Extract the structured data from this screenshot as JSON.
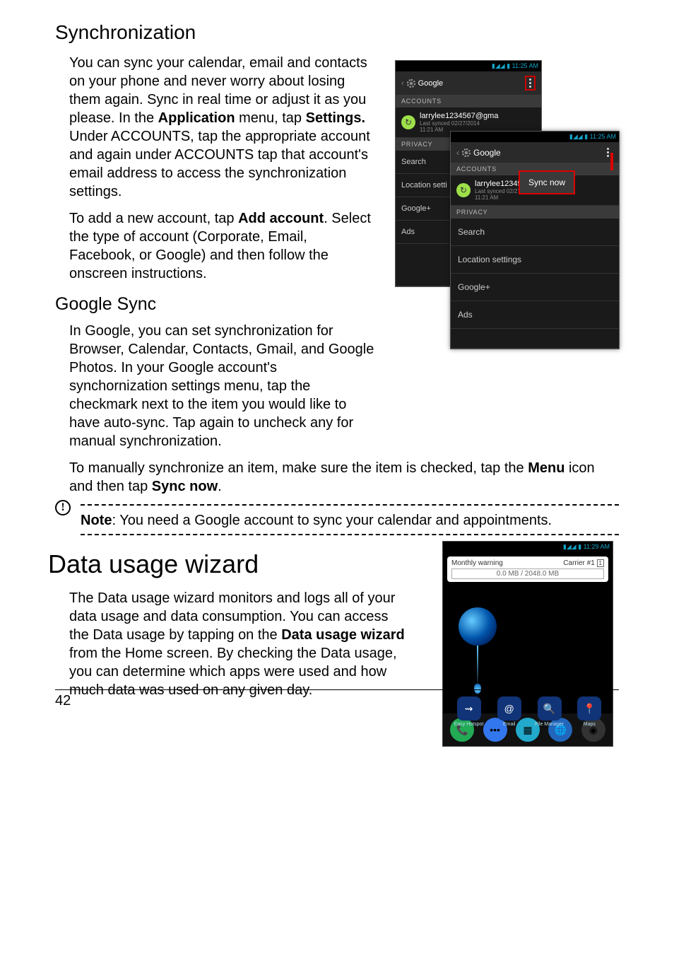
{
  "sync": {
    "heading": "Synchronization",
    "p1_a": "You can sync your calendar, email and contacts on your phone and never worry about losing them again. Sync in real time or adjust it as you please. In the ",
    "p1_b": "Application",
    "p1_c": " menu, tap ",
    "p1_d": "Settings.",
    "p1_e": " Under ACCOUNTS, tap the appropriate account and again under ACCOUNTS tap that account's email address to access the synchronization settings.",
    "p2_a": "To add a new account, tap ",
    "p2_b": "Add account",
    "p2_c": ". Select the type of account (Corporate, Email, Facebook, or Google) and then follow the onscreen instructions."
  },
  "gsync": {
    "heading": "Google Sync",
    "p1": "In Google, you can set synchronization for Browser, Calendar, Contacts, Gmail, and Google Photos. In your Google account's synchornization settings menu, tap the checkmark next to the item you would like to have auto-sync. Tap again to uncheck any for manual synchronization.",
    "p2_a": "To manually synchronize an item, make sure the item is checked, tap the ",
    "p2_b": "Menu",
    "p2_c": " icon and then tap ",
    "p2_d": "Sync now",
    "p2_e": "."
  },
  "note": {
    "label": "Note",
    "text": ": You need a Google account to sync your calendar and appointments."
  },
  "data": {
    "heading": "Data usage wizard",
    "p1_a": "The Data usage wizard monitors and logs all of your data usage and data consumption. You can access the Data usage by tapping on the ",
    "p1_b": "Data usage wizard",
    "p1_c": " from the Home screen. By checking the Data usage, you can determine which apps were used and how much data was used on any given day."
  },
  "page_number": "42",
  "phone1": {
    "time": "11:25 AM",
    "title": "Google",
    "accounts": "ACCOUNTS",
    "email": "larrylee1234567@gma",
    "synced": "Last synced 02/27/2014",
    "syncedtime": "11:21 AM",
    "privacy": "PRIVACY",
    "items": {
      "search": "Search",
      "location": "Location setti",
      "googleplus": "Google+",
      "ads": "Ads"
    }
  },
  "phone2": {
    "time": "11:25 AM",
    "title": "Google",
    "accounts": "ACCOUNTS",
    "email": "larrylee1234567@gma",
    "synced": "Last synced 02/27/2014",
    "syncedtime": "11:21 AM",
    "privacy": "PRIVACY",
    "items": {
      "search": "Search",
      "location": "Location settings",
      "googleplus": "Google+",
      "ads": "Ads"
    },
    "popup": "Sync now"
  },
  "phone3": {
    "time": "11:29 AM",
    "widget_title": "Monthly warning",
    "carrier": "Carrier #1",
    "usage": "0.0 MB / 2048.0 MB",
    "dock": {
      "hotspot": "Easy Hotspot",
      "email": "Email",
      "files": "File Manager",
      "maps": "Maps"
    }
  }
}
